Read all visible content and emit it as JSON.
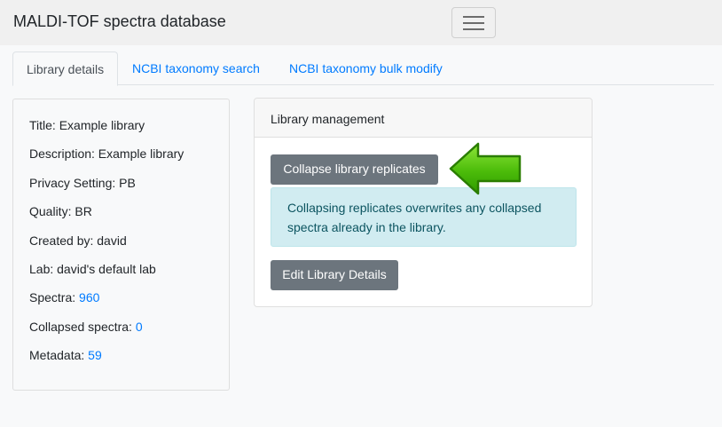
{
  "app": {
    "title": "MALDI-TOF spectra database"
  },
  "tabs": [
    {
      "label": "Library details",
      "active": true
    },
    {
      "label": "NCBI taxonomy search",
      "active": false
    },
    {
      "label": "NCBI taxonomy bulk modify",
      "active": false
    }
  ],
  "library": {
    "title_label": "Title: Example library",
    "description_label": "Description: Example library",
    "privacy_label": "Privacy Setting: PB",
    "quality_label": "Quality: BR",
    "created_label": "Created by: david",
    "lab_label": "Lab: david's default lab",
    "spectra_prefix": "Spectra: ",
    "spectra_count": "960",
    "collapsed_prefix": "Collapsed spectra: ",
    "collapsed_count": "0",
    "metadata_prefix": "Metadata: ",
    "metadata_count": "59"
  },
  "management": {
    "title": "Library management",
    "collapse_button": "Collapse library replicates",
    "alert_text": "Collapsing replicates overwrites any collapsed spectra already in the library.",
    "edit_button": "Edit Library Details"
  },
  "icons": {
    "menu": "hamburger-menu-icon",
    "arrow": "green-left-arrow-icon"
  },
  "colors": {
    "link": "#007bff",
    "button": "#6c757d",
    "alert_bg": "#d1ecf1",
    "alert_text": "#0c5460",
    "arrow": "#44bb00"
  }
}
